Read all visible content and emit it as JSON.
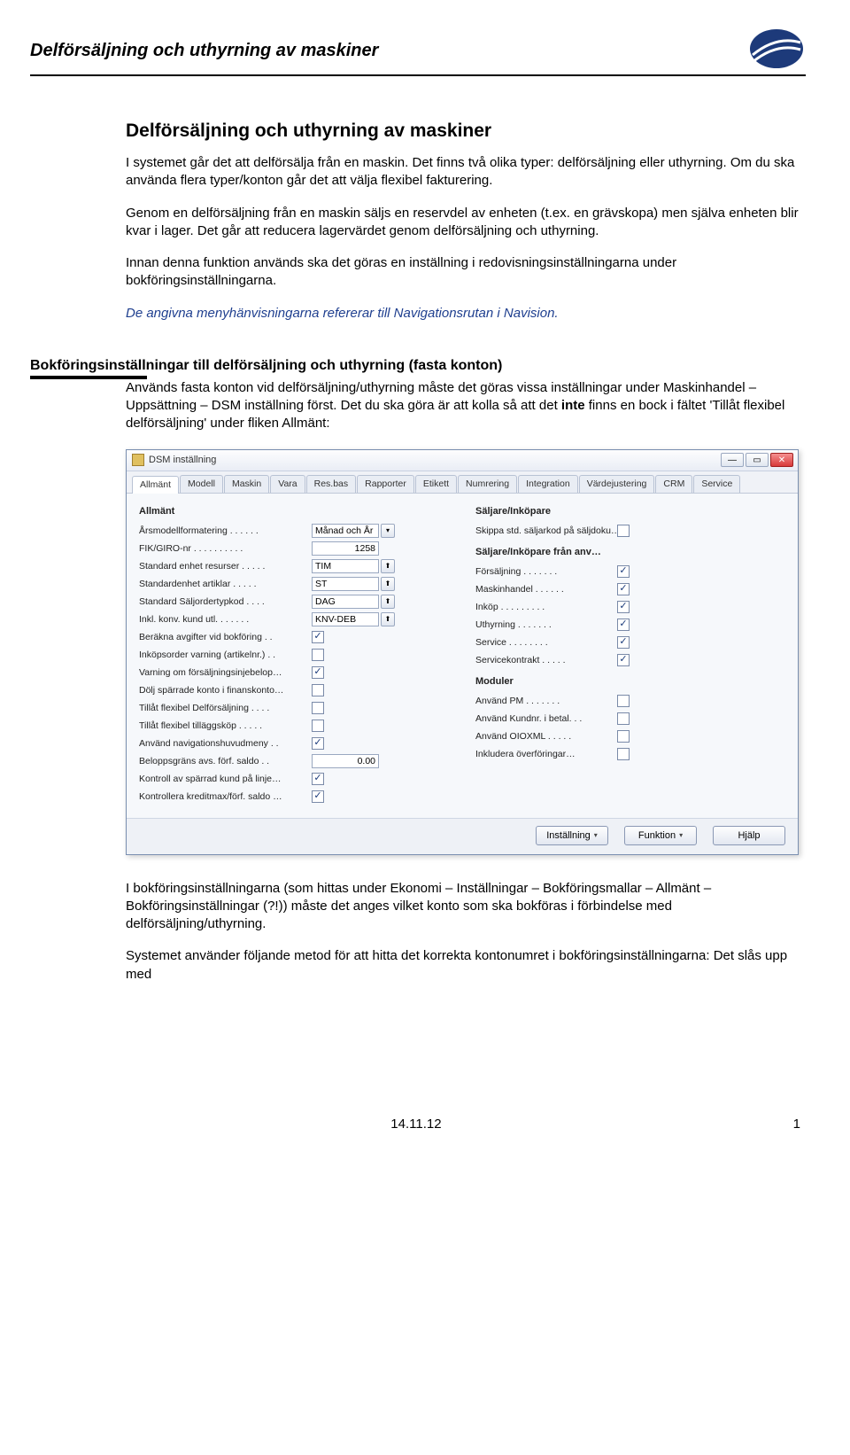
{
  "header": {
    "title": "Delförsäljning och uthyrning av maskiner"
  },
  "section1": {
    "title": "Delförsäljning och uthyrning av maskiner",
    "p1": "I systemet går det att delförsälja från en maskin. Det finns två olika typer: delförsäljning eller uthyrning. Om du ska använda flera typer/konton går det att välja flexibel fakturering.",
    "p2": "Genom en delförsäljning från en maskin säljs en reservdel av enheten (t.ex. en grävskopa) men själva enheten blir kvar i lager. Det går att reducera lagervärdet genom delförsäljning och uthyrning.",
    "p3": "Innan denna funktion används ska det göras en inställning i redovisningsinställningarna under bokföringsinställningarna.",
    "p4_blue": "De angivna menyhänvisningarna refererar till Navigationsrutan i Navision."
  },
  "section2": {
    "title": "Bokföringsinställningar till delförsäljning och uthyrning (fasta konton)",
    "p1a": "Används fasta konton vid delförsäljning/uthyrning måste det göras vissa inställningar under Maskinhandel – Uppsättning – DSM inställning först. Det du ska göra är att kolla så att det ",
    "p1b_bold": "inte",
    "p1c": " finns en bock i fältet 'Tillåt flexibel delförsäljning' under fliken Allmänt:"
  },
  "dialog": {
    "title": "DSM inställning",
    "tabs": [
      "Allmänt",
      "Modell",
      "Maskin",
      "Vara",
      "Res.bas",
      "Rapporter",
      "Etikett",
      "Numrering",
      "Integration",
      "Värdejustering",
      "CRM",
      "Service"
    ],
    "group_left": "Allmänt",
    "left_fields": [
      {
        "label": "Årsmodellformatering . . . . . .",
        "ctrl": "dropdown",
        "value": "Månad och År"
      },
      {
        "label": "FIK/GIRO-nr . . . . . . . . . .",
        "ctrl": "text",
        "value": "1258"
      },
      {
        "label": "Standard enhet resurser . . . . .",
        "ctrl": "lookup",
        "value": "TIM"
      },
      {
        "label": "Standardenhet artiklar . . . . .",
        "ctrl": "lookup",
        "value": "ST"
      },
      {
        "label": "Standard Säljordertypkod . . . .",
        "ctrl": "lookup",
        "value": "DAG"
      },
      {
        "label": "Inkl. konv. kund utl. . . . . . .",
        "ctrl": "lookup",
        "value": "KNV-DEB"
      },
      {
        "label": "Beräkna avgifter vid bokföring . .",
        "ctrl": "check",
        "checked": true
      },
      {
        "label": "Inköpsorder varning (artikelnr.) . .",
        "ctrl": "check",
        "checked": false
      },
      {
        "label": "Varning om försäljningsinjebelop…",
        "ctrl": "check",
        "checked": true
      },
      {
        "label": "Dölj spärrade konto i finanskonto…",
        "ctrl": "check",
        "checked": false
      },
      {
        "label": "Tillåt flexibel Delförsäljning . . . .",
        "ctrl": "check",
        "checked": false
      },
      {
        "label": "Tillåt flexibel tilläggsköp . . . . .",
        "ctrl": "check",
        "checked": false
      },
      {
        "label": "Använd navigationshuvudmeny . .",
        "ctrl": "check",
        "checked": true
      },
      {
        "label": "Beloppsgräns avs. förf. saldo  . .",
        "ctrl": "text",
        "value": "0.00"
      },
      {
        "label": "Kontroll av spärrad kund på linje…",
        "ctrl": "check",
        "checked": true
      },
      {
        "label": "Kontrollera kreditmax/förf. saldo …",
        "ctrl": "check",
        "checked": true
      }
    ],
    "group_r1": "Säljare/Inköpare",
    "right1_fields": [
      {
        "label": "Skippa std. säljarkod på säljdoku…",
        "ctrl": "check",
        "checked": false
      }
    ],
    "group_r2": "Säljare/Inköpare från anv…",
    "right2_fields": [
      {
        "label": "Försäljning . . . . . . .",
        "ctrl": "check",
        "checked": true
      },
      {
        "label": "Maskinhandel . . . . . .",
        "ctrl": "check",
        "checked": true
      },
      {
        "label": "Inköp . . . . . . . . .",
        "ctrl": "check",
        "checked": true
      },
      {
        "label": "Uthyrning . . . . . . .",
        "ctrl": "check",
        "checked": true
      },
      {
        "label": "Service . . . . . . . .",
        "ctrl": "check",
        "checked": true
      },
      {
        "label": "Servicekontrakt . . . . .",
        "ctrl": "check",
        "checked": true
      }
    ],
    "group_r3": "Moduler",
    "right3_fields": [
      {
        "label": "Använd PM . . . . . . .",
        "ctrl": "check",
        "checked": false
      },
      {
        "label": "Använd Kundnr. i betal. . .",
        "ctrl": "check",
        "checked": false
      },
      {
        "label": "Använd OIOXML . . . . .",
        "ctrl": "check",
        "checked": false
      },
      {
        "label": "Inkludera överföringar…",
        "ctrl": "check",
        "checked": false
      }
    ],
    "buttons": [
      "Inställning",
      "Funktion",
      "Hjälp"
    ]
  },
  "after": {
    "p1": "I bokföringsinställningarna (som hittas under Ekonomi – Inställningar – Bokföringsmallar – Allmänt – Bokföringsinställningar (?!)) måste det anges vilket konto som ska bokföras i förbindelse med delförsäljning/uthyrning.",
    "p2": "Systemet använder följande metod för att hitta det korrekta kontonumret i bokföringsinställningarna: Det slås upp med"
  },
  "footer": {
    "date": "14.11.12",
    "page": "1"
  }
}
